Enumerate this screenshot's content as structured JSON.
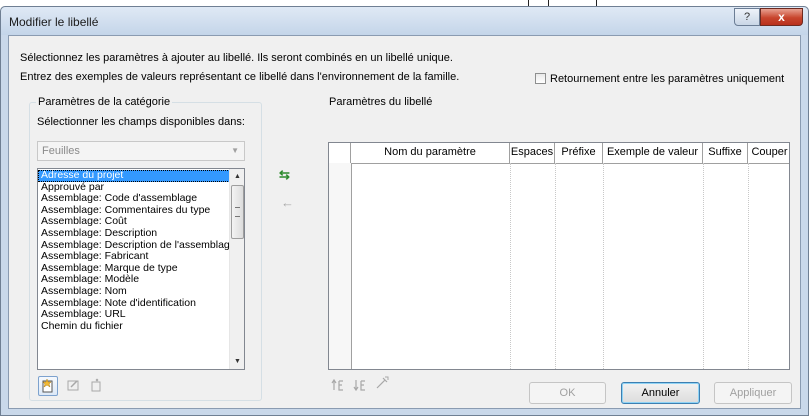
{
  "window": {
    "title": "Modifier le libellé",
    "help_glyph": "?",
    "close_glyph": "x"
  },
  "instructions": {
    "line1": "Sélectionnez les paramètres à ajouter au libellé. Ils seront combinés en un libellé unique.",
    "line2": "Entrez des exemples de valeurs représentant ce libellé dans l'environnement de la famille."
  },
  "options": {
    "flip_label": "Retournement entre les paramètres uniquement",
    "flip_checked": false
  },
  "category": {
    "group_title": "Paramètres de la catégorie",
    "select_label": "Sélectionner les champs disponibles dans:",
    "combo_value": "Feuilles",
    "fields": [
      "Adresse du projet",
      "Approuvé par",
      "Assemblage: Code d'assemblage",
      "Assemblage: Commentaires du type",
      "Assemblage: Coût",
      "Assemblage: Description",
      "Assemblage: Description de l'assemblage",
      "Assemblage: Fabricant",
      "Assemblage: Marque de type",
      "Assemblage: Modèle",
      "Assemblage: Nom",
      "Assemblage: Note d'identification",
      "Assemblage: URL",
      "Chemin du fichier"
    ],
    "selected_index": 0
  },
  "label_params": {
    "group_title": "Paramètres du libellé",
    "columns": [
      "Nom du paramètre",
      "Espaces",
      "Préfixe",
      "Exemple de valeur",
      "Suffixe",
      "Couper"
    ],
    "rows": []
  },
  "icons": {
    "add_param": "add-parameter-icon",
    "remove_param": "remove-parameter-icon",
    "new_param": "new-parameter-icon",
    "edit_param": "edit-parameter-icon",
    "delete_param": "delete-parameter-icon",
    "move_up": "move-up-icon",
    "move_down": "move-down-icon",
    "edit_label": "edit-label-icon"
  },
  "buttons": {
    "ok": "OK",
    "cancel": "Annuler",
    "apply": "Appliquer"
  },
  "colors": {
    "selection": "#3399ff",
    "add_arrow": "#2e8b2e",
    "close_button": "#c8452d"
  }
}
